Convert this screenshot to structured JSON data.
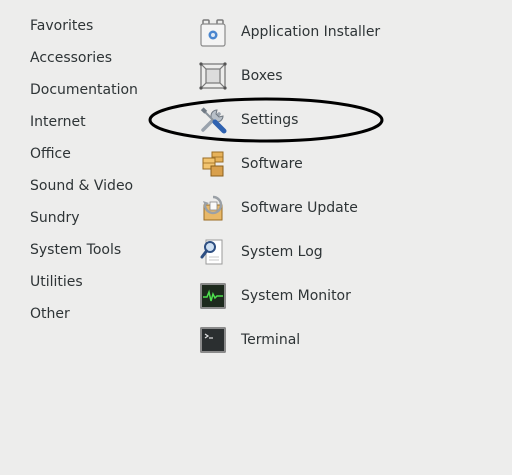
{
  "categories": [
    {
      "label": "Favorites"
    },
    {
      "label": "Accessories"
    },
    {
      "label": "Documentation"
    },
    {
      "label": "Internet"
    },
    {
      "label": "Office"
    },
    {
      "label": "Sound & Video"
    },
    {
      "label": "Sundry"
    },
    {
      "label": "System Tools"
    },
    {
      "label": "Utilities"
    },
    {
      "label": "Other"
    }
  ],
  "apps": [
    {
      "label": "Application Installer",
      "icon": "application-installer-icon"
    },
    {
      "label": "Boxes",
      "icon": "boxes-icon"
    },
    {
      "label": "Settings",
      "icon": "settings-icon"
    },
    {
      "label": "Software",
      "icon": "software-icon"
    },
    {
      "label": "Software Update",
      "icon": "software-update-icon"
    },
    {
      "label": "System Log",
      "icon": "system-log-icon"
    },
    {
      "label": "System Monitor",
      "icon": "system-monitor-icon"
    },
    {
      "label": "Terminal",
      "icon": "terminal-icon"
    }
  ],
  "colors": {
    "background": "#ededec",
    "text": "#2e3436",
    "annotation": "#000000"
  }
}
